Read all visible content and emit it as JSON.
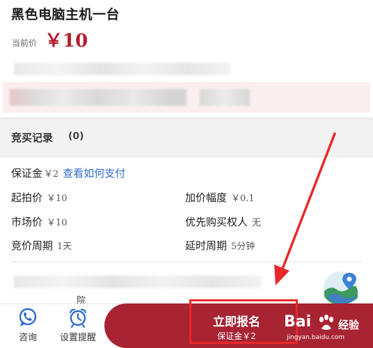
{
  "item": {
    "title": "黑色电脑主机一台",
    "current_price_label": "当前价",
    "current_price": "￥10"
  },
  "bid_records": {
    "label": "竞买记录",
    "count": "(0)"
  },
  "details": {
    "deposit_label": "保证金",
    "deposit_value": "￥2",
    "deposit_link": "查看如何支付",
    "start_price_label": "起拍价",
    "start_price_value": "￥10",
    "increment_label": "加价幅度",
    "increment_value": "￥0.1",
    "market_price_label": "市场价",
    "market_price_value": "￥10",
    "priority_label": "优先购买权人",
    "priority_value": "无",
    "period_label": "竞价周期",
    "period_value": "1天",
    "delay_label": "延时周期",
    "delay_value": "5分钟",
    "court_partial": "院"
  },
  "bottom_bar": {
    "consult_label": "咨询",
    "remind_label": "设置提醒",
    "apply_label": "立即报名",
    "apply_sub": "保证金￥2"
  },
  "watermark": {
    "brand": "Bai",
    "brand_cn": "经验",
    "url": "jingyan.baidu.com"
  },
  "colors": {
    "accent": "#a82432",
    "price": "#b31f2c",
    "link": "#2d6cc9",
    "highlight": "#e8282b"
  }
}
